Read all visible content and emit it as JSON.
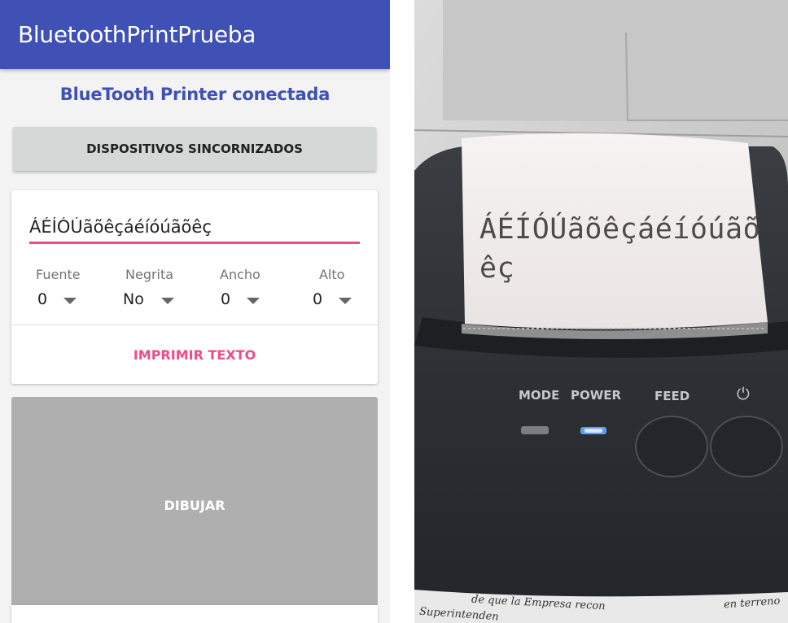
{
  "app": {
    "title": "BluetoothPrintPrueba",
    "status": "BlueTooth Printer conectada",
    "devices_button": "DISPOSITIVOS SINCORNIZADOS",
    "text_input": {
      "value": "ÁÉÍÓÚãõêçáéíóúãõêç"
    },
    "options": [
      {
        "label": "Fuente",
        "value": "0"
      },
      {
        "label": "Negrita",
        "value": "No"
      },
      {
        "label": "Ancho",
        "value": "0"
      },
      {
        "label": "Alto",
        "value": "0"
      }
    ],
    "print_button": "IMPRIMIR TEXTO",
    "draw_button": "DIBUJAR",
    "colors": {
      "primary": "#3f51b5",
      "accent": "#ee4b87"
    }
  },
  "photo": {
    "receipt_lines": [
      "ÁÉÍÓÚãõêçáéíóúãõ",
      "êç"
    ],
    "printer_labels": {
      "mode": "MODE",
      "power": "POWER",
      "feed": "FEED"
    },
    "icons": [
      "power-icon"
    ],
    "document_text": {
      "line1": "de que la Empresa recon",
      "line2": "Superintenden",
      "right": "en terreno"
    },
    "colors": {
      "power_led": "#3a7bff"
    }
  }
}
